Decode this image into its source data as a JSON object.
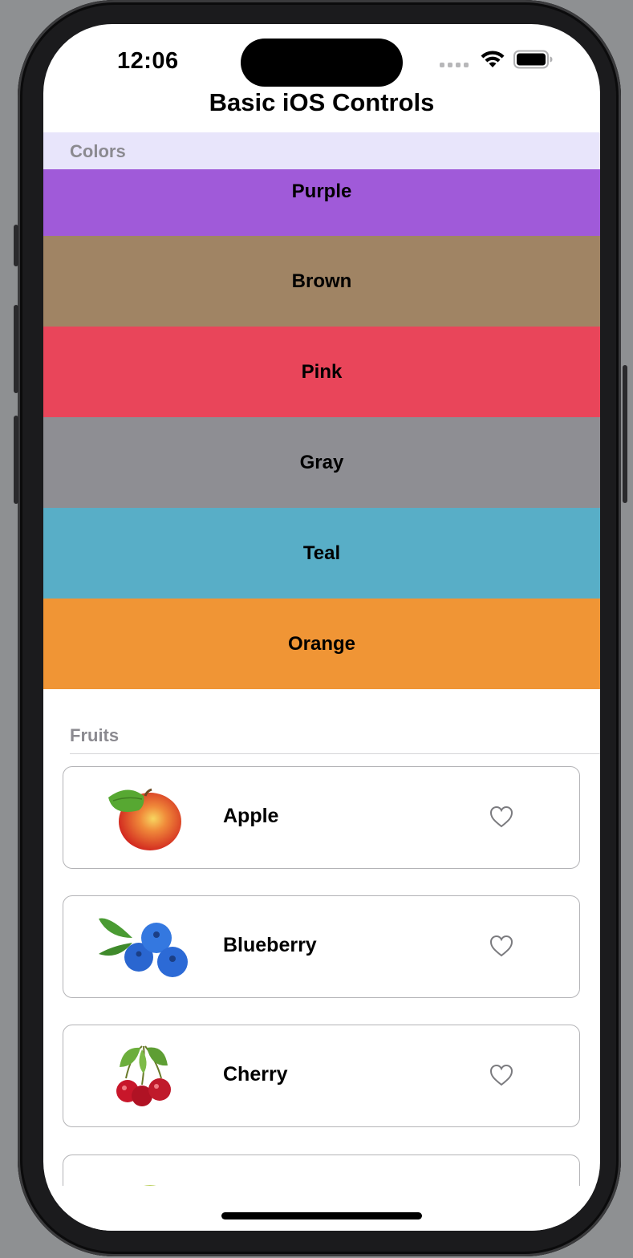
{
  "status_bar": {
    "time": "12:06"
  },
  "navigation": {
    "title": "Basic iOS Controls"
  },
  "colors_section": {
    "header": "Colors",
    "items": [
      {
        "label": "Purple",
        "color": "#a05ad9"
      },
      {
        "label": "Brown",
        "color": "#a08464"
      },
      {
        "label": "Pink",
        "color": "#e9455a"
      },
      {
        "label": "Gray",
        "color": "#8e8e93"
      },
      {
        "label": "Teal",
        "color": "#58aec7"
      },
      {
        "label": "Orange",
        "color": "#f09535"
      }
    ]
  },
  "fruits_section": {
    "header": "Fruits",
    "items": [
      {
        "name": "Apple",
        "icon": "apple-image",
        "favorite_icon": "heart-outline-icon"
      },
      {
        "name": "Blueberry",
        "icon": "blueberry-image",
        "favorite_icon": "heart-outline-icon"
      },
      {
        "name": "Cherry",
        "icon": "cherry-image",
        "favorite_icon": "heart-outline-icon"
      }
    ]
  }
}
